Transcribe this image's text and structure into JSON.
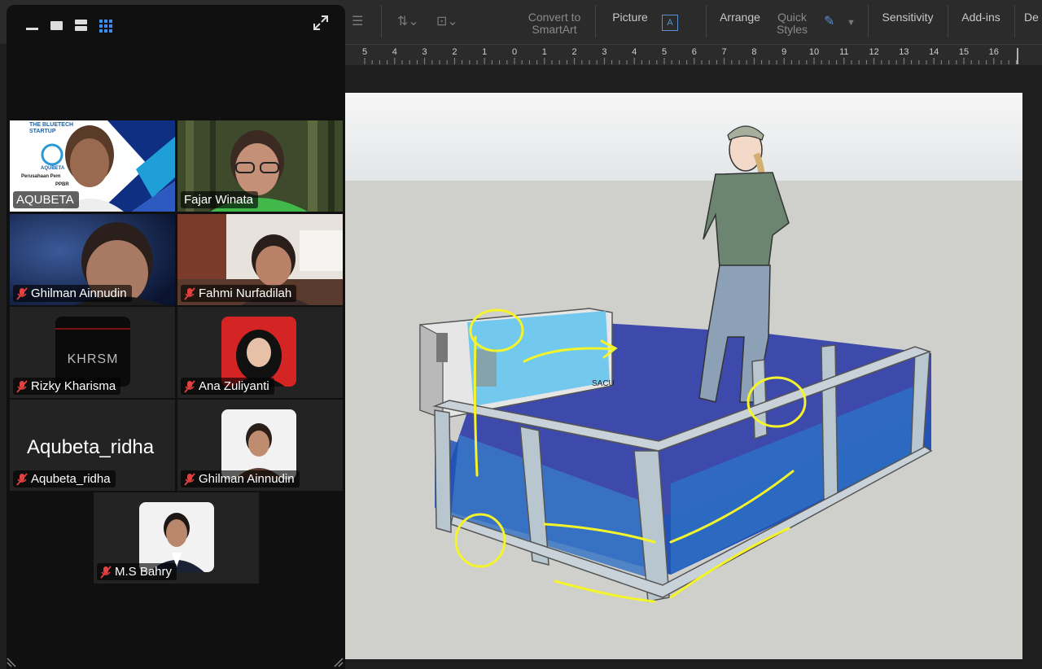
{
  "ribbon": {
    "convert_to_smartart": "Convert to\nSmartArt",
    "picture": "Picture",
    "arrange": "Arrange",
    "quick_styles": "Quick\nStyles",
    "sensitivity": "Sensitivity",
    "add_ins": "Add-ins",
    "designer": "De"
  },
  "ruler": {
    "ticks": [
      "5",
      "4",
      "3",
      "2",
      "1",
      "0",
      "1",
      "2",
      "3",
      "4",
      "5",
      "6",
      "7",
      "8",
      "9",
      "10",
      "11",
      "12",
      "13",
      "14",
      "15",
      "16"
    ]
  },
  "meeting": {
    "participants": [
      {
        "name": "AQUBETA",
        "muted": false,
        "active": true
      },
      {
        "name": "Fajar Winata",
        "muted": false,
        "active": false
      },
      {
        "name": "Ghilman Ainnudin",
        "muted": true,
        "active": false
      },
      {
        "name": "Fahmi Nurfadilah",
        "muted": true,
        "active": false
      },
      {
        "name": "Rizky Kharisma",
        "muted": true,
        "active": false
      },
      {
        "name": "Ana Zuliyanti",
        "muted": true,
        "active": false
      },
      {
        "name": "Aqubeta_ridha",
        "muted": true,
        "active": false
      },
      {
        "name": "Ghilman Ainnudin",
        "muted": true,
        "active": false
      },
      {
        "name": "M.S Bahry",
        "muted": true,
        "active": false
      }
    ],
    "aqubeta_card": {
      "startup": "THE BLUETECH\nSTARTUP",
      "brand": "AQUBETA",
      "company": "Perusahaan Pem",
      "code": "PPBR"
    },
    "rizky_logo": "KHRSM",
    "placeholder_name": "Aqubeta_ridha"
  },
  "slide": {
    "tank_label": "SACU"
  },
  "colors": {
    "active_border": "#3cc64a",
    "mute_red": "#e34141",
    "annotation": "#f4f42a",
    "accent": "#5a8fd1"
  }
}
